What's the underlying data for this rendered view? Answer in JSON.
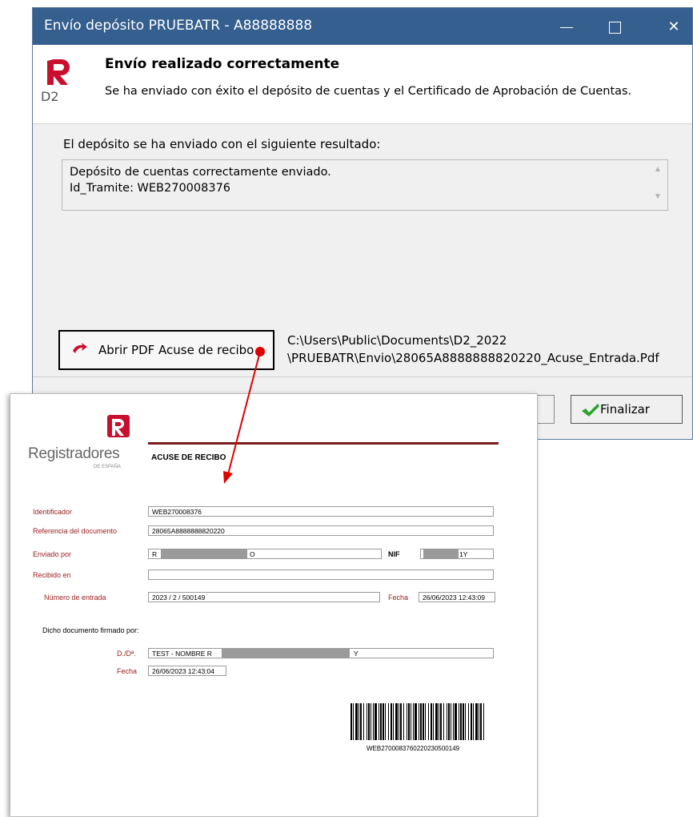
{
  "window": {
    "title": "Envío depósito PRUEBATR - A88888888",
    "controls": {
      "minimize": "minimize",
      "maximize": "maximize",
      "close": "✕"
    }
  },
  "header": {
    "logo_text": "D2",
    "heading": "Envío realizado correctamente",
    "message": "Se ha enviado con éxito el depósito de cuentas y el Certificado de Aprobación de Cuentas."
  },
  "result": {
    "label": "El depósito se ha enviado con el siguiente resultado:",
    "lines": [
      "Depósito de cuentas correctamente enviado.",
      "Id_Tramite: WEB270008376"
    ]
  },
  "pdf": {
    "button_label": "Abrir PDF Acuse de recibo",
    "path_line1": "C:\\Users\\Public\\Documents\\D2_2022",
    "path_line2": "\\PRUEBATR\\Envio\\28065A8888888820220_Acuse_Entrada.Pdf"
  },
  "footer": {
    "finish_label": "Finalizar"
  },
  "receipt": {
    "org_name": "Registradores",
    "org_sub": "DE ESPAÑA",
    "title": "ACUSE DE RECIBO",
    "fields": {
      "identificador_label": "Identificador",
      "identificador_value": "WEB270008376",
      "referencia_label": "Referencia del documento",
      "referencia_value": "28065A8888888820220",
      "enviado_label": "Enviado por",
      "enviado_value": "R",
      "enviado_tail": "O",
      "nif_label": "NIF",
      "nif_value": "1Y",
      "recibido_label": "Recibido en",
      "recibido_value": "",
      "numero_label": "Número de entrada",
      "numero_value": "2023 / 2 / 500149",
      "fecha_label": "Fecha",
      "fecha_value": "26/06/2023 12:43:09"
    },
    "signed": {
      "heading": "Dicho documento firmado por:",
      "dd_label": "D./Dª.",
      "dd_value": "TEST - NOMBRE R",
      "dd_tail": "Y",
      "fecha_label": "Fecha",
      "fecha_value": "26/06/2023 12:43:04"
    },
    "barcode_text": "WEB2700083760220230500149"
  },
  "colors": {
    "titlebar": "#355f8e",
    "brand_red": "#c8102e",
    "receipt_label_red": "#9a1b1b",
    "arrow_red": "#e00000",
    "check_green": "#2aa52a"
  }
}
